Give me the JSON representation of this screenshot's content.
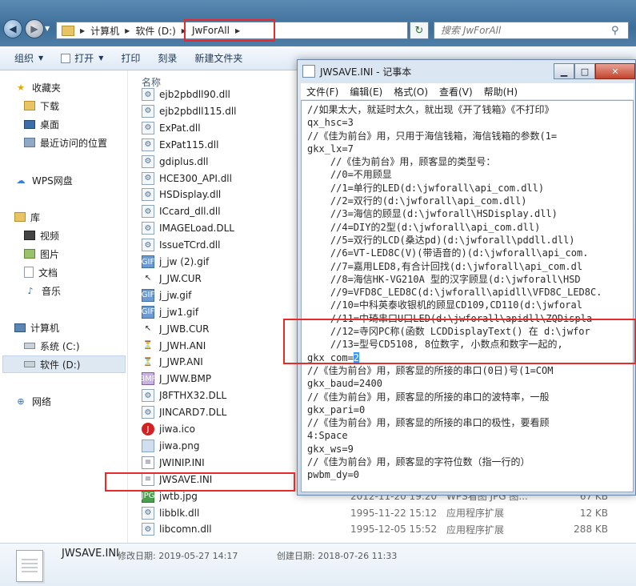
{
  "addressbar": {
    "crumbs": [
      "计算机",
      "软件 (D:)",
      "JwForAll"
    ],
    "search_placeholder": "搜索 JwForAll"
  },
  "toolbar": {
    "organize": "组织",
    "open": "打开",
    "print": "打印",
    "burn": "刻录",
    "new_folder": "新建文件夹"
  },
  "nav": {
    "favorites": "收藏夹",
    "downloads": "下载",
    "desktop": "桌面",
    "recent": "最近访问的位置",
    "wps": "WPS网盘",
    "libraries": "库",
    "videos": "视频",
    "pictures": "图片",
    "documents": "文档",
    "music": "音乐",
    "computer": "计算机",
    "drive_c": "系统 (C:)",
    "drive_d": "软件 (D:)",
    "network": "网络"
  },
  "filelist": {
    "col_name": "名称",
    "files": [
      {
        "name": "ejb2pbdll90.dll",
        "icon": "dll-icon",
        "date": "",
        "type": "",
        "size": ""
      },
      {
        "name": "ejb2pbdll115.dll",
        "icon": "dll-icon",
        "date": "",
        "type": "",
        "size": ""
      },
      {
        "name": "ExPat.dll",
        "icon": "dll-icon",
        "date": "",
        "type": "",
        "size": ""
      },
      {
        "name": "ExPat115.dll",
        "icon": "dll-icon",
        "date": "",
        "type": "",
        "size": ""
      },
      {
        "name": "gdiplus.dll",
        "icon": "dll-icon",
        "date": "",
        "type": "",
        "size": ""
      },
      {
        "name": "HCE300_API.dll",
        "icon": "dll-icon",
        "date": "",
        "type": "",
        "size": ""
      },
      {
        "name": "HSDisplay.dll",
        "icon": "dll-icon",
        "date": "",
        "type": "",
        "size": ""
      },
      {
        "name": "ICcard_dll.dll",
        "icon": "dll-icon",
        "date": "",
        "type": "",
        "size": ""
      },
      {
        "name": "IMAGELoad.DLL",
        "icon": "dll-icon",
        "date": "",
        "type": "",
        "size": ""
      },
      {
        "name": "IssueTCrd.dll",
        "icon": "dll-icon",
        "date": "",
        "type": "",
        "size": ""
      },
      {
        "name": "j_jw (2).gif",
        "icon": "gif-icon",
        "date": "",
        "type": "",
        "size": ""
      },
      {
        "name": "J_JW.CUR",
        "icon": "cursor-icon",
        "date": "",
        "type": "",
        "size": ""
      },
      {
        "name": "j_jw.gif",
        "icon": "gif-icon",
        "date": "",
        "type": "",
        "size": ""
      },
      {
        "name": "j_jw1.gif",
        "icon": "gif-icon",
        "date": "",
        "type": "",
        "size": ""
      },
      {
        "name": "J_JWB.CUR",
        "icon": "cursor-icon",
        "date": "",
        "type": "",
        "size": ""
      },
      {
        "name": "J_JWH.ANI",
        "icon": "animated-cursor-icon",
        "date": "",
        "type": "",
        "size": ""
      },
      {
        "name": "J_JWP.ANI",
        "icon": "animated-cursor-icon",
        "date": "",
        "type": "",
        "size": ""
      },
      {
        "name": "J_JWW.BMP",
        "icon": "bmp-icon",
        "date": "",
        "type": "",
        "size": ""
      },
      {
        "name": "J8FTHX32.DLL",
        "icon": "dll-icon",
        "date": "",
        "type": "",
        "size": ""
      },
      {
        "name": "JINCARD7.DLL",
        "icon": "dll-icon",
        "date": "",
        "type": "",
        "size": ""
      },
      {
        "name": "jiwa.ico",
        "icon": "ico-icon",
        "date": "",
        "type": "",
        "size": ""
      },
      {
        "name": "jiwa.png",
        "icon": "png-icon",
        "date": "",
        "type": "",
        "size": ""
      },
      {
        "name": "JWINIP.INI",
        "icon": "ini-icon",
        "date": "",
        "type": "",
        "size": ""
      },
      {
        "name": "JWSAVE.INI",
        "icon": "ini-icon",
        "date": "",
        "type": "",
        "size": ""
      },
      {
        "name": "jwtb.jpg",
        "icon": "jpg-icon",
        "date": "2012-11-20 19:20",
        "type": "WPS看图 JPG 图...",
        "size": "67 KB"
      },
      {
        "name": "libblk.dll",
        "icon": "dll-icon",
        "date": "1995-11-22 15:12",
        "type": "应用程序扩展",
        "size": "12 KB"
      },
      {
        "name": "libcomn.dll",
        "icon": "dll-icon",
        "date": "1995-12-05 15:52",
        "type": "应用程序扩展",
        "size": "288 KB"
      }
    ]
  },
  "statusbar": {
    "filename": "JWSAVE.INI",
    "modified": "修改日期: 2019-05-27 14:17",
    "created": "创建日期: 2018-07-26 11:33"
  },
  "notepad": {
    "title": "JWSAVE.INI - 记事本",
    "menu": [
      "文件(F)",
      "编辑(E)",
      "格式(O)",
      "查看(V)",
      "帮助(H)"
    ],
    "lines": [
      "//如果太大，就延时太久，就出现《开了钱箱》《不打印》",
      "qx_hsc=3",
      "//《佳为前台》用，只用于海信钱箱，海信钱箱的参数(1=",
      "gkx_lx=7",
      "    //《佳为前台》用，顾客显的类型号：",
      "    //0=不用顾显",
      "    //1=单行的LED(d:\\jwforall\\api_com.dll)",
      "    //2=双行的(d:\\jwforall\\api_com.dll)",
      "    //3=海信的顾显(d:\\jwforall\\HSDisplay.dll)",
      "    //4=DIY的2型(d:\\jwforall\\api_com.dll)",
      "    //5=双行的LCD(桑达pd)(d:\\jwforall\\pddll.dll)",
      "    //6=VT-LED8C(V)(带语音的)(d:\\jwforall\\api_com.",
      "    //7=嘉用LED8,有合计回找(d:\\jwforall\\api_com.dl",
      "    //8=海信HK-VG210A 型的汉字顾显(d:\\jwforall\\HSD",
      "    //9=VFD8C_LED8C(d:\\jwforall\\apidll\\VFD8C_LED8C.",
      "    //10=中科英泰收银机的顾显CD109,CD110(d:\\jwforal",
      "    //11=中琦串口U口LED(d:\\jwforall\\apidll\\ZQDispla",
      "    //12=寺冈PC称(函数 LCDDisplayText() 在 d:\\jwfor",
      "    //13=型号CD5108, 8位数字, 小数点和数字一起的,",
      "gkx_com=",
      "//《佳为前台》用，顾客显的所接的串口(0日)号(1=COM",
      "gkx_baud=2400",
      "//《佳为前台》用，顾客显的所接的串口的波特率，一般",
      "gkx_pari=0",
      "//《佳为前台》用，顾客显的所接的串口的极性，要看顾",
      "4:Space",
      "gkx_ws=9",
      "//《佳为前台》用，顾客显的字符位数（指一行的）",
      "pwbm_dy=0"
    ],
    "caret_value": "2"
  }
}
